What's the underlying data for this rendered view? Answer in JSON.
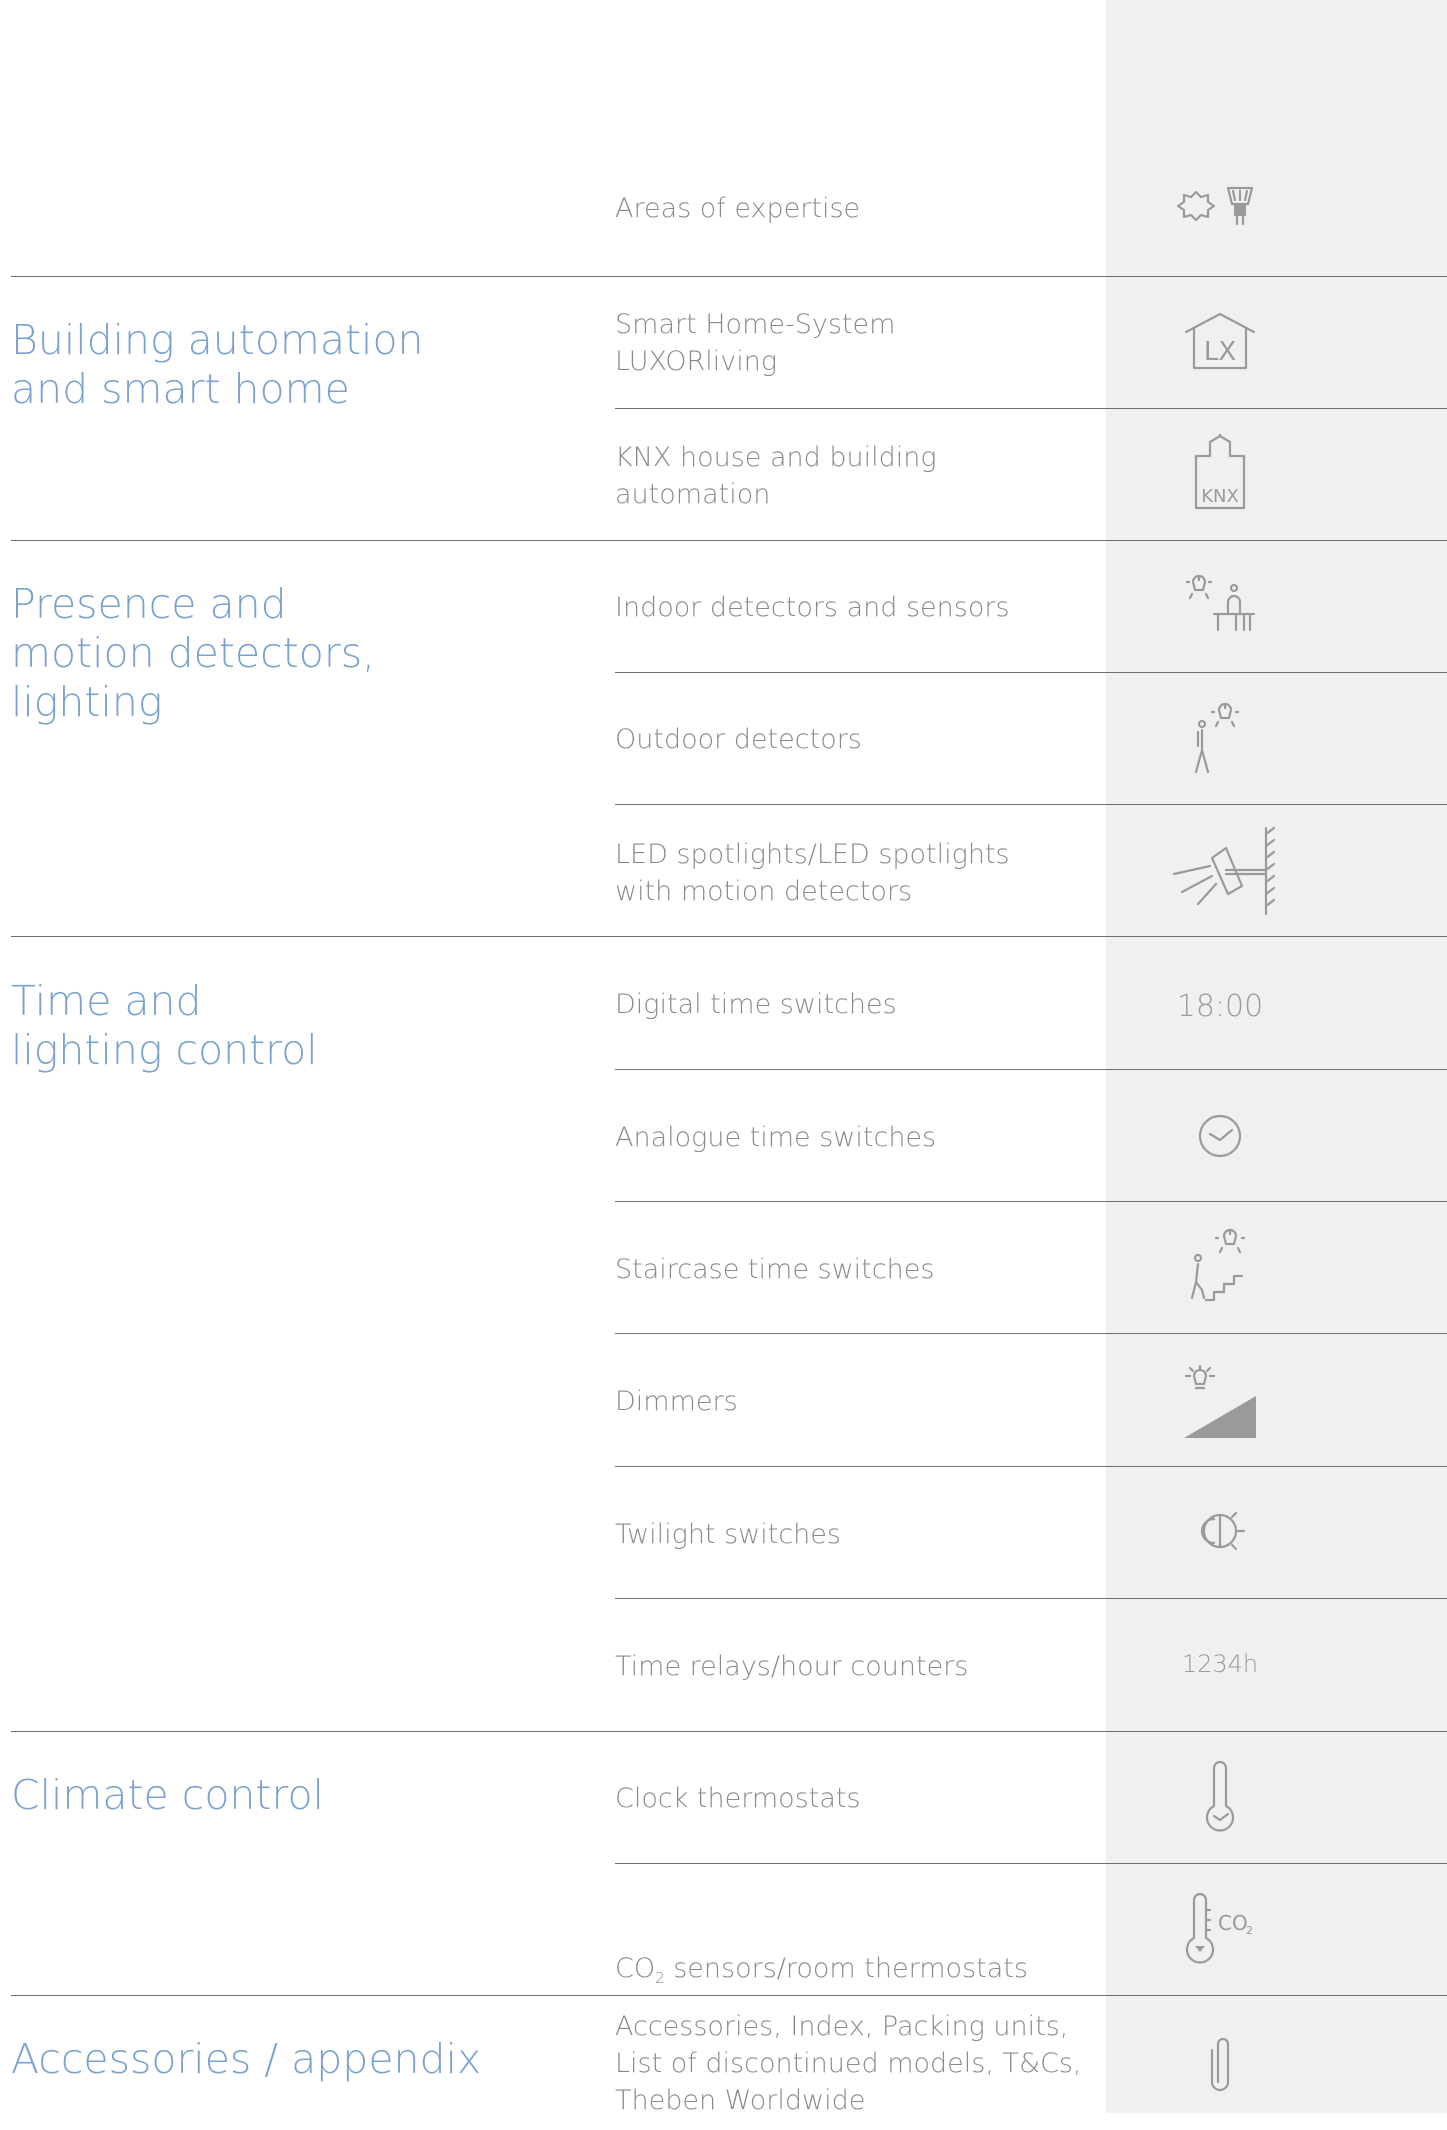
{
  "header": {
    "label": "Areas of expertise",
    "icon": "sun-and-spotlight-icon"
  },
  "colors": {
    "category": "#7aa2cf",
    "text": "#8a8a8a",
    "strip": "#f0f0f0",
    "rule": "#6f6f6f",
    "icon": "#9a9a9a"
  },
  "categories": [
    {
      "title": "Building automation\nand smart home"
    },
    {
      "title": "Presence and\nmotion detectors,\nlighting"
    },
    {
      "title": "Time and\nlighting control"
    },
    {
      "title": "Climate control"
    },
    {
      "title": "Accessories / appendix"
    }
  ],
  "items": [
    {
      "label": "Smart Home-System\nLUXORliving",
      "icon": "lx-house-icon",
      "icon_text": "LX"
    },
    {
      "label": "KNX house and building\nautomation",
      "icon": "knx-building-icon",
      "icon_text": "KNX"
    },
    {
      "label": "Indoor detectors and sensors",
      "icon": "indoor-detector-icon"
    },
    {
      "label": "Outdoor detectors",
      "icon": "outdoor-detector-icon"
    },
    {
      "label": "LED spotlights/LED spotlights\nwith motion detectors",
      "icon": "led-spotlight-icon"
    },
    {
      "label": "Digital time switches",
      "icon": "digital-clock-icon",
      "icon_text": "18:00"
    },
    {
      "label": "Analogue time switches",
      "icon": "analogue-clock-icon"
    },
    {
      "label": "Staircase time switches",
      "icon": "staircase-icon"
    },
    {
      "label": "Dimmers",
      "icon": "dimmer-icon"
    },
    {
      "label": "Twilight switches",
      "icon": "twilight-icon"
    },
    {
      "label": "Time relays/hour counters",
      "icon": "hour-counter-icon",
      "icon_text": "1234h"
    },
    {
      "label": "Clock thermostats",
      "icon": "thermostat-icon"
    },
    {
      "label_before": "CO",
      "label_sub": "2",
      "label_after": " sensors/room thermostats",
      "icon": "co2-thermometer-icon",
      "icon_text": "CO",
      "icon_sub": "2"
    },
    {
      "label": "Accessories, Index, Packing units,\nList of discontinued models, T&Cs,\nTheben Worldwide",
      "icon": "paperclip-icon"
    }
  ]
}
